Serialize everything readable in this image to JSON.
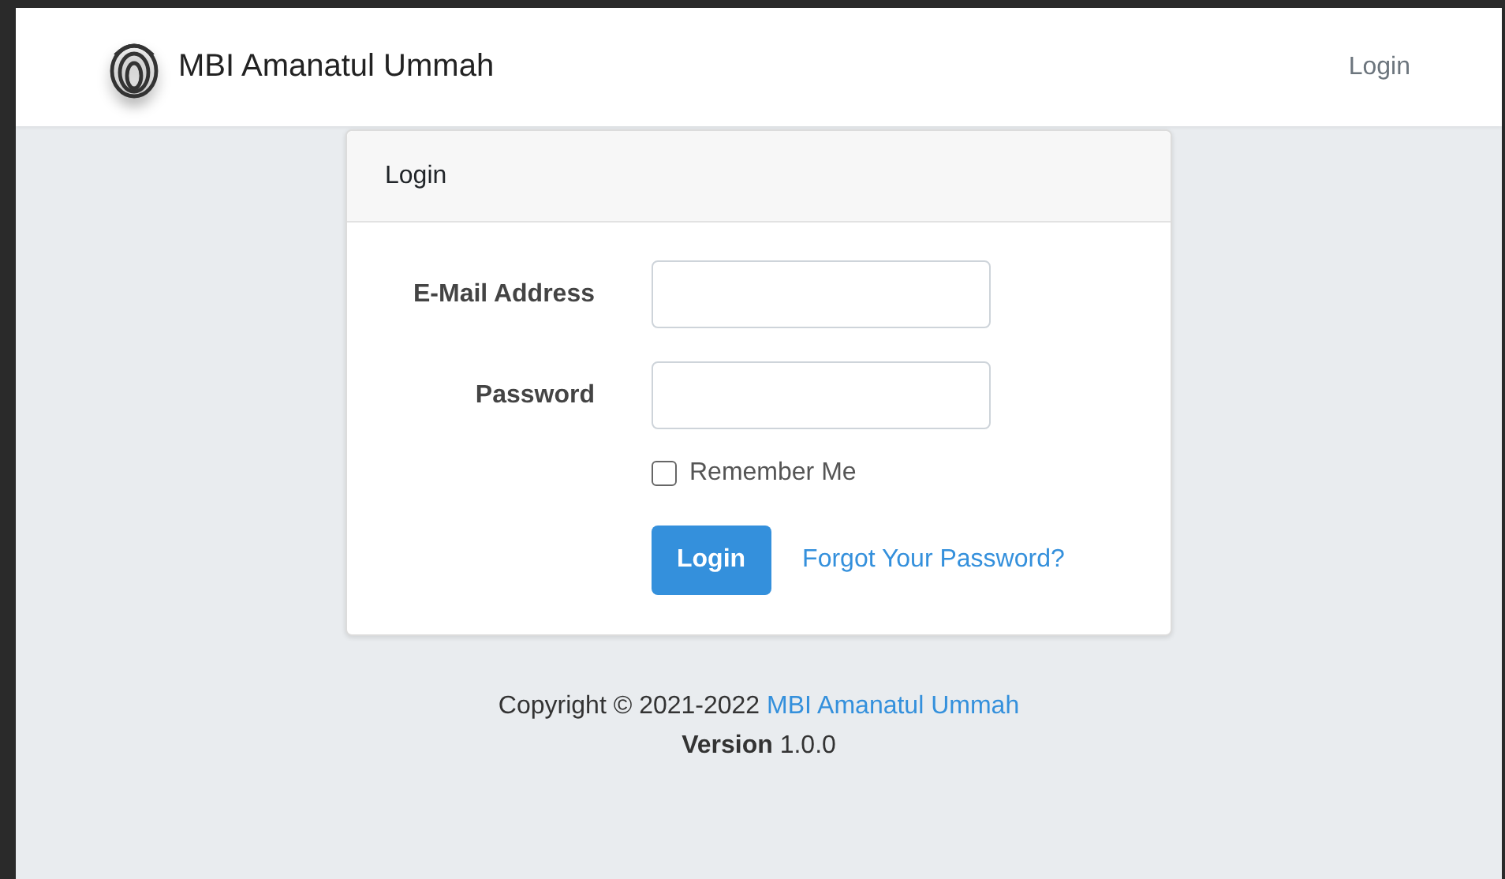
{
  "navbar": {
    "brand": "MBI Amanatul Ummah",
    "links": [
      {
        "label": "Login"
      }
    ]
  },
  "card": {
    "title": "Login",
    "fields": [
      {
        "label": "E-Mail Address"
      },
      {
        "label": "Password"
      }
    ],
    "remember": {
      "label": "Remember Me",
      "checked": false
    },
    "submit": "Login",
    "forgot_link": "Forgot Your Password?"
  },
  "footer": {
    "copyright": "Copyright © 2021-2022",
    "owner_link": "MBI Amanatul Ummah",
    "version": "**Version** 1.0.0"
  }
}
